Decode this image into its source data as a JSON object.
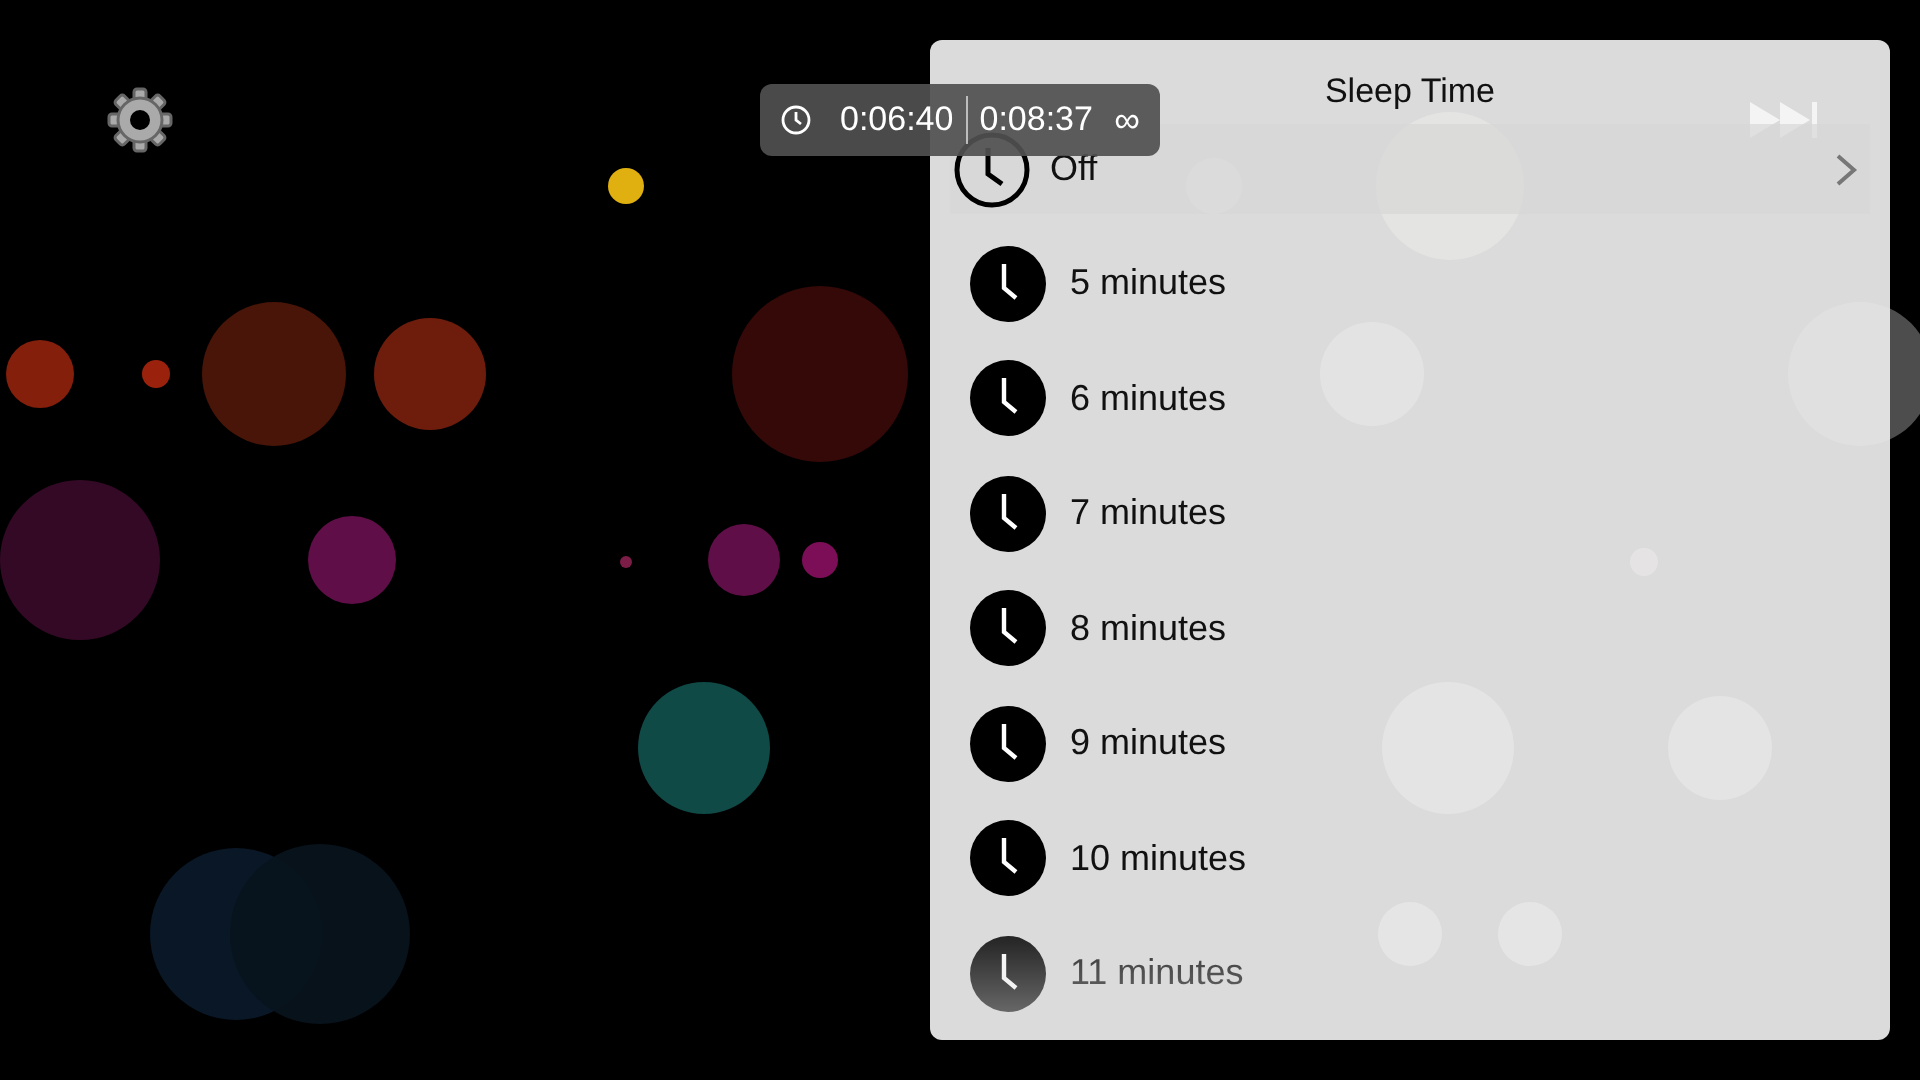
{
  "player": {
    "elapsed": "0:06:40",
    "duration": "0:08:37",
    "repeat": "∞"
  },
  "sleep_menu": {
    "title": "Sleep Time",
    "items": [
      {
        "label": "Off",
        "selected": true
      },
      {
        "label": "5 minutes",
        "selected": false
      },
      {
        "label": "6 minutes",
        "selected": false
      },
      {
        "label": "7 minutes",
        "selected": false
      },
      {
        "label": "8 minutes",
        "selected": false
      },
      {
        "label": "9 minutes",
        "selected": false
      },
      {
        "label": "10 minutes",
        "selected": false
      },
      {
        "label": "11 minutes",
        "selected": false
      }
    ]
  }
}
